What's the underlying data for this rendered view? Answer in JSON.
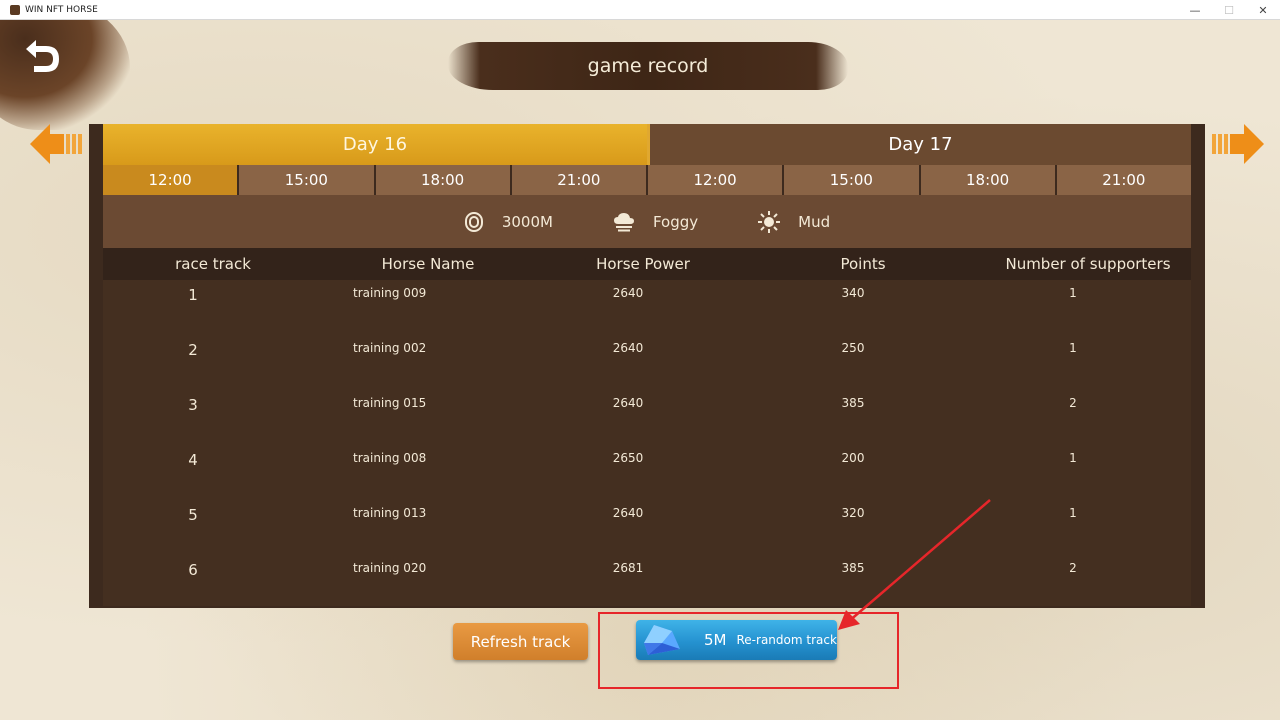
{
  "window": {
    "title": "WIN NFT HORSE",
    "minimize": "—",
    "maximize": "☐",
    "close": "✕"
  },
  "header": {
    "title": "game record"
  },
  "days": [
    {
      "label": "Day 16",
      "active": true
    },
    {
      "label": "Day 17",
      "active": false
    }
  ],
  "times": [
    {
      "label": "12:00",
      "active": true
    },
    {
      "label": "15:00",
      "active": false
    },
    {
      "label": "18:00",
      "active": false
    },
    {
      "label": "21:00",
      "active": false
    },
    {
      "label": "12:00",
      "active": false
    },
    {
      "label": "15:00",
      "active": false
    },
    {
      "label": "18:00",
      "active": false
    },
    {
      "label": "21:00",
      "active": false
    }
  ],
  "conditions": {
    "distance": {
      "icon": "track-icon",
      "value": "3000M"
    },
    "weather": {
      "icon": "cloud-icon",
      "value": "Foggy"
    },
    "ground": {
      "icon": "sun-icon",
      "value": "Mud"
    }
  },
  "table": {
    "headers": {
      "track": "race track",
      "name": "Horse Name",
      "power": "Horse Power",
      "points": "Points",
      "supporters": "Number of supporters"
    },
    "rows": [
      {
        "track": "1",
        "name": "training 009",
        "power": "2640",
        "points": "340",
        "supporters": "1"
      },
      {
        "track": "2",
        "name": "training 002",
        "power": "2640",
        "points": "250",
        "supporters": "1"
      },
      {
        "track": "3",
        "name": "training 015",
        "power": "2640",
        "points": "385",
        "supporters": "2"
      },
      {
        "track": "4",
        "name": "training 008",
        "power": "2650",
        "points": "200",
        "supporters": "1"
      },
      {
        "track": "5",
        "name": "training 013",
        "power": "2640",
        "points": "320",
        "supporters": "1"
      },
      {
        "track": "6",
        "name": "training 020",
        "power": "2681",
        "points": "385",
        "supporters": "2"
      }
    ]
  },
  "buttons": {
    "refresh": "Refresh track",
    "rerandom_cost": "5M",
    "rerandom_label": "Re-random track"
  },
  "colors": {
    "accent_gold": "#e9b32c",
    "panel_brown": "#3d2a1e",
    "refresh_orange": "#e99a43",
    "rerandom_blue": "#2592d0",
    "annotation_red": "#e6262a"
  }
}
